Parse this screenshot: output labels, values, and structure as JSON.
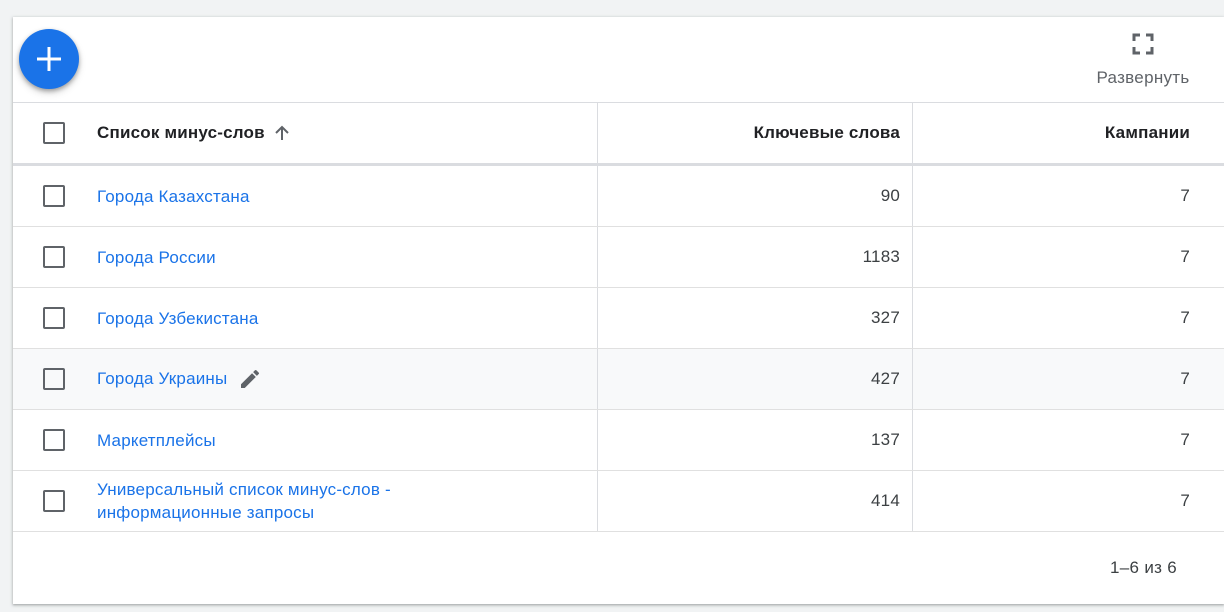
{
  "toolbar": {
    "add_icon": "plus-icon",
    "expand_icon": "fullscreen-icon",
    "expand_label": "Развернуть"
  },
  "table": {
    "columns": {
      "name": "Список минус-слов",
      "keywords": "Ключевые слова",
      "campaigns": "Кампании"
    },
    "sort": "ascending",
    "rows": [
      {
        "name": "Города Казахстана",
        "keywords": "90",
        "campaigns": "7"
      },
      {
        "name": "Города России",
        "keywords": "1183",
        "campaigns": "7"
      },
      {
        "name": "Города Узбекистана",
        "keywords": "327",
        "campaigns": "7"
      },
      {
        "name": "Города Украины",
        "keywords": "427",
        "campaigns": "7"
      },
      {
        "name": "Маркетплейсы",
        "keywords": "137",
        "campaigns": "7"
      },
      {
        "name": "Универсальный список минус-слов - информационные запросы",
        "keywords": "414",
        "campaigns": "7"
      }
    ]
  },
  "footer": {
    "pagination": "1–6 из 6"
  },
  "colors": {
    "accent": "#1a73e8",
    "hover_row": "#f8f9fa"
  }
}
